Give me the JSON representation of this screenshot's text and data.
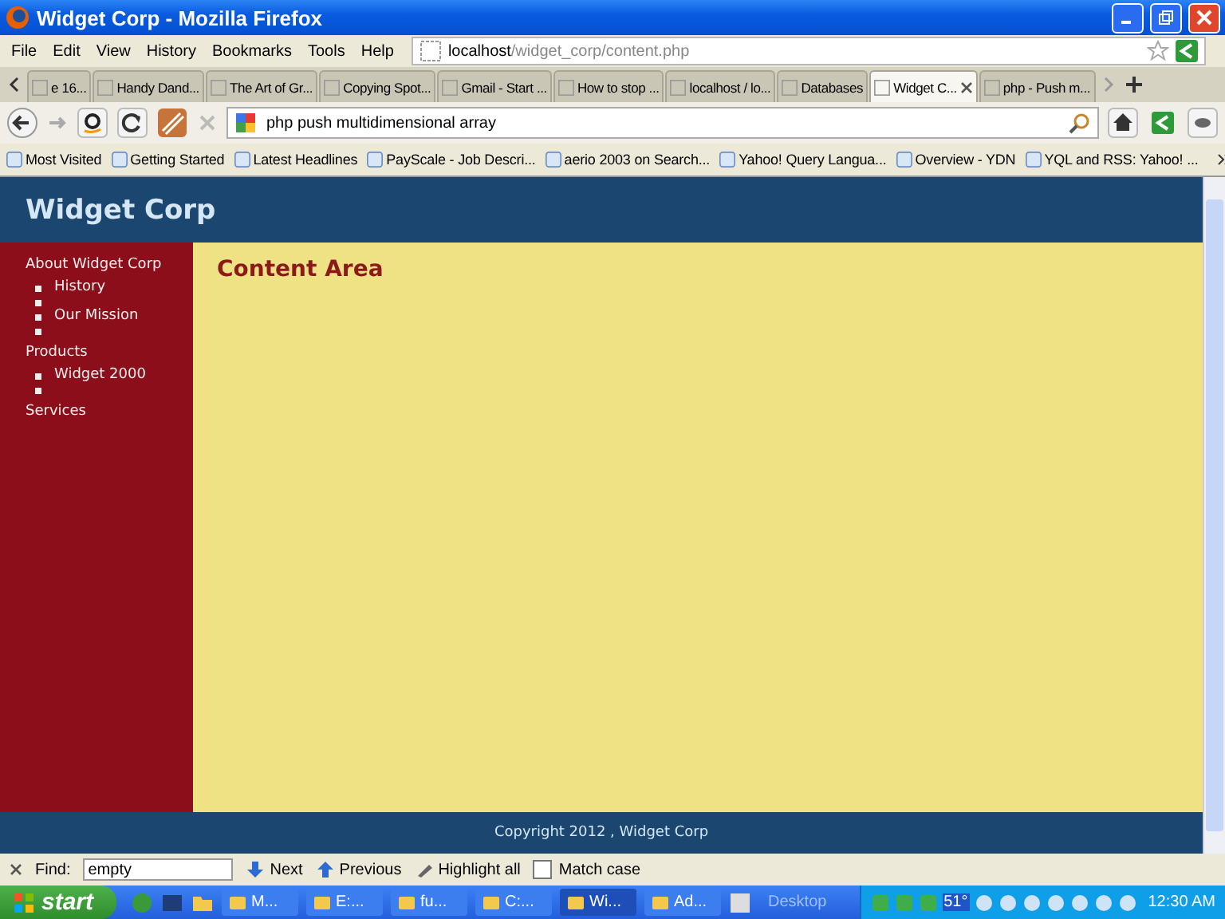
{
  "window": {
    "title": "Widget Corp - Mozilla Firefox"
  },
  "menu": [
    "File",
    "Edit",
    "View",
    "History",
    "Bookmarks",
    "Tools",
    "Help"
  ],
  "address": {
    "host": "localhost",
    "path": "/widget_corp/content.php"
  },
  "tabs": [
    {
      "label": "e 16...",
      "selected": false
    },
    {
      "label": "Handy Dand...",
      "selected": false
    },
    {
      "label": "The Art of Gr...",
      "selected": false
    },
    {
      "label": "Copying Spot...",
      "selected": false
    },
    {
      "label": "Gmail - Start ...",
      "selected": false
    },
    {
      "label": "How to stop ...",
      "selected": false
    },
    {
      "label": "localhost / lo...",
      "selected": false
    },
    {
      "label": "Databases",
      "selected": false
    },
    {
      "label": "Widget C...",
      "selected": true
    },
    {
      "label": "php - Push m...",
      "selected": false
    }
  ],
  "search": {
    "value": "php push multidimensional array"
  },
  "bookmarks": [
    "Most Visited",
    "Getting Started",
    "Latest Headlines",
    "PayScale - Job Descri...",
    "aerio 2003 on Search...",
    "Yahoo! Query Langua...",
    "Overview - YDN",
    "YQL and RSS: Yahoo! ..."
  ],
  "site": {
    "title": "Widget Corp",
    "subjects": [
      {
        "name": "About Widget Corp",
        "pages": [
          {
            "name": "History",
            "empty_item_after": true
          },
          {
            "name": "Our Mission",
            "empty_item_after": true
          }
        ]
      },
      {
        "name": "Products",
        "pages": [
          {
            "name": "Widget 2000",
            "empty_item_after": true
          }
        ]
      },
      {
        "name": "Services"
      }
    ],
    "content_title": "Content Area",
    "footer": "Copyright 2012 , Widget Corp"
  },
  "find_bar": {
    "label": "Find:",
    "value": "empty",
    "buttons": [
      "Next",
      "Previous",
      "Highlight all"
    ],
    "match_case": {
      "label": "Match case",
      "checked": false
    }
  },
  "taskbar": {
    "start": "start",
    "tasks": [
      {
        "label": "M...",
        "selected": false
      },
      {
        "label": "E:...",
        "selected": false
      },
      {
        "label": "fu...",
        "selected": false
      },
      {
        "label": "C:...",
        "selected": false
      },
      {
        "label": "Wi...",
        "selected": true
      },
      {
        "label": "Ad...",
        "selected": false
      }
    ],
    "desktop": "Desktop",
    "temperature": "51°",
    "clock": "12:30 AM"
  }
}
